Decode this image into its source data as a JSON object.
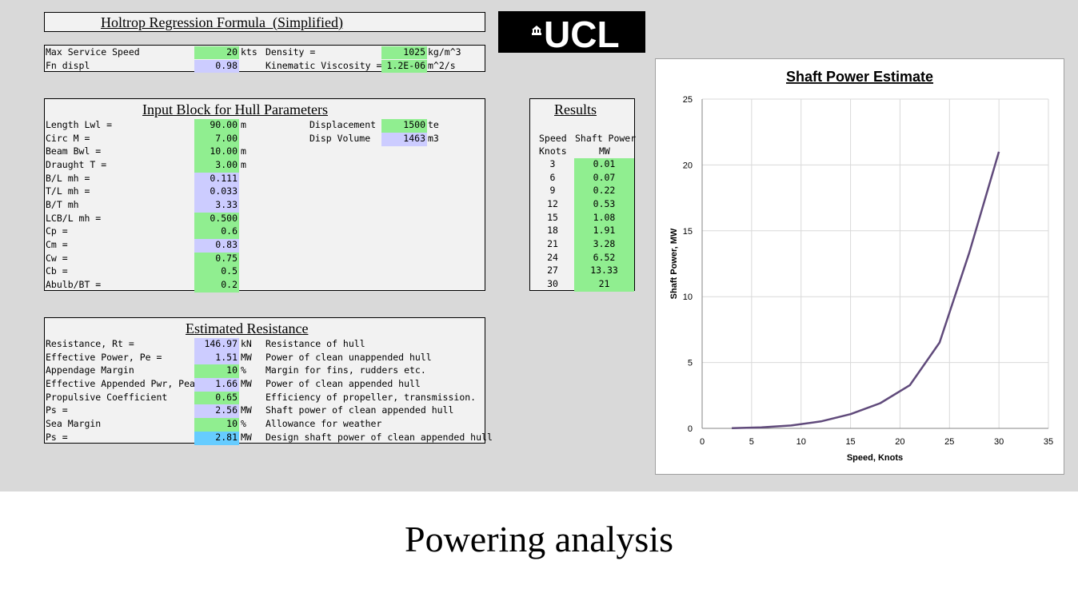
{
  "header": {
    "title": "Holtrop Regression Formula  (Simplified)",
    "logo_text": "UCL",
    "rows": [
      {
        "label": "Max Service Speed",
        "value": "20",
        "unit": "kts",
        "label2": "Density =",
        "value2": "1025",
        "unit2": "kg/m^3"
      },
      {
        "label": "Fn displ",
        "value": "0.98",
        "unit": "",
        "label2": "Kinematic Viscosity =",
        "value2": "1.2E-06",
        "unit2": "m^2/s"
      }
    ]
  },
  "hull": {
    "title": "Input Block for Hull Parameters",
    "rows": [
      {
        "label": "Length Lwl =",
        "value": "90.00",
        "unit": "m",
        "type": "green"
      },
      {
        "label": "Circ M =",
        "value": "7.00",
        "unit": "",
        "type": "green"
      },
      {
        "label": "Beam Bwl =",
        "value": "10.00",
        "unit": "m",
        "type": "green"
      },
      {
        "label": "Draught T =",
        "value": "3.00",
        "unit": "m",
        "type": "green"
      },
      {
        "label": "B/L mh =",
        "value": "0.111",
        "unit": "",
        "type": "lav"
      },
      {
        "label": "T/L mh =",
        "value": "0.033",
        "unit": "",
        "type": "lav"
      },
      {
        "label": "B/T mh",
        "value": "3.33",
        "unit": "",
        "type": "lav"
      },
      {
        "label": "LCB/L mh =",
        "value": "0.500",
        "unit": "",
        "type": "green"
      },
      {
        "label": "Cp =",
        "value": "0.6",
        "unit": "",
        "type": "green"
      },
      {
        "label": "Cm =",
        "value": "0.83",
        "unit": "",
        "type": "lav"
      },
      {
        "label": "Cw =",
        "value": "0.75",
        "unit": "",
        "type": "green"
      },
      {
        "label": "Cb =",
        "value": "0.5",
        "unit": "",
        "type": "green"
      },
      {
        "label": "Abulb/BT =",
        "value": "0.2",
        "unit": "",
        "type": "green"
      }
    ],
    "disp": [
      {
        "label": "Displacement",
        "value": "1500",
        "unit": "te",
        "type": "green"
      },
      {
        "label": "Disp Volume",
        "value": "1463",
        "unit": "m3",
        "type": "lav"
      }
    ]
  },
  "resistance": {
    "title": "Estimated Resistance",
    "rows": [
      {
        "label": "Resistance, Rt =",
        "value": "146.97",
        "unit": "kN",
        "desc": "Resistance of hull",
        "type": "lav"
      },
      {
        "label": "Effective Power, Pe =",
        "value": "1.51",
        "unit": "MW",
        "desc": "Power of clean unappended hull",
        "type": "lav"
      },
      {
        "label": "Appendage Margin",
        "value": "10",
        "unit": "%",
        "desc": "Margin for fins, rudders etc.",
        "type": "green"
      },
      {
        "label": "Effective Appended Pwr, Pea",
        "value": "1.66",
        "unit": "MW",
        "desc": "Power of clean appended hull",
        "type": "lav"
      },
      {
        "label": "Propulsive Coefficient",
        "value": "0.65",
        "unit": "",
        "desc": "Efficiency of propeller, transmission.",
        "type": "green"
      },
      {
        "label": "Ps =",
        "value": "2.56",
        "unit": "MW",
        "desc": "Shaft power of clean appended hull",
        "type": "lav"
      },
      {
        "label": "Sea Margin",
        "value": "10",
        "unit": "%",
        "desc": "Allowance for weather",
        "type": "green"
      },
      {
        "label": "Ps =",
        "value": "2.81",
        "unit": "MW",
        "desc": "Design shaft power of clean appended hull",
        "type": "blue"
      }
    ]
  },
  "results": {
    "title": "Results",
    "col1_header": "Speed",
    "col1_unit": "Knots",
    "col2_header": "Shaft Power",
    "col2_unit": "MW",
    "rows": [
      {
        "speed": "3",
        "power": "0.01"
      },
      {
        "speed": "6",
        "power": "0.07"
      },
      {
        "speed": "9",
        "power": "0.22"
      },
      {
        "speed": "12",
        "power": "0.53"
      },
      {
        "speed": "15",
        "power": "1.08"
      },
      {
        "speed": "18",
        "power": "1.91"
      },
      {
        "speed": "21",
        "power": "3.28"
      },
      {
        "speed": "24",
        "power": "6.52"
      },
      {
        "speed": "27",
        "power": "13.33"
      },
      {
        "speed": "30",
        "power": "21"
      }
    ]
  },
  "chart_data": {
    "type": "line",
    "title": "Shaft Power Estimate",
    "xlabel": "Speed, Knots",
    "ylabel": "Shaft Power, MW",
    "xlim": [
      0,
      35
    ],
    "ylim": [
      0,
      25
    ],
    "xticks": [
      0,
      5,
      10,
      15,
      20,
      25,
      30,
      35
    ],
    "yticks": [
      0,
      5,
      10,
      15,
      20,
      25
    ],
    "grid": true,
    "x": [
      3,
      6,
      9,
      12,
      15,
      18,
      21,
      24,
      27,
      30
    ],
    "series": [
      {
        "values": [
          0.01,
          0.07,
          0.22,
          0.53,
          1.08,
          1.91,
          3.28,
          6.52,
          13.33,
          21
        ],
        "color": "#604a7b"
      }
    ]
  },
  "caption": "Powering analysis"
}
